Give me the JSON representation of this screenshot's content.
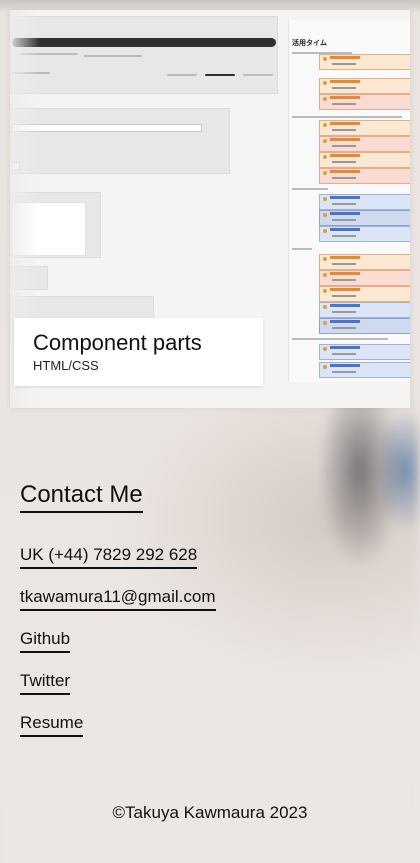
{
  "portfolio_card": {
    "title": "Component parts",
    "subtitle": "HTML/CSS",
    "preview_right_title": "活用タイム"
  },
  "contact": {
    "heading": "Contact Me",
    "phone": "UK (+44) 7829 292 628",
    "email": "tkawamura11@gmail.com",
    "github": "Github",
    "twitter": "Twitter",
    "resume": "Resume"
  },
  "footer": {
    "copyright": "©Takuya Kawmaura 2023"
  }
}
